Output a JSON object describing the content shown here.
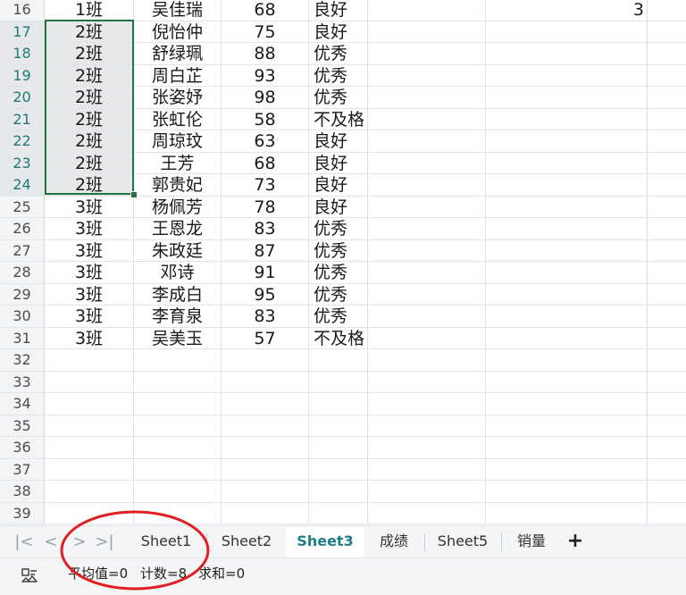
{
  "grid": {
    "rows": [
      {
        "num": "16",
        "selected": false,
        "a": "1班",
        "b": "吴佳瑞",
        "c": "68",
        "d": "良好",
        "f": "3"
      },
      {
        "num": "17",
        "selected": true,
        "a": "2班",
        "b": "倪怡仲",
        "c": "75",
        "d": "良好",
        "f": ""
      },
      {
        "num": "18",
        "selected": true,
        "a": "2班",
        "b": "舒绿珮",
        "c": "88",
        "d": "优秀",
        "f": ""
      },
      {
        "num": "19",
        "selected": true,
        "a": "2班",
        "b": "周白芷",
        "c": "93",
        "d": "优秀",
        "f": ""
      },
      {
        "num": "20",
        "selected": true,
        "a": "2班",
        "b": "张姿妤",
        "c": "98",
        "d": "优秀",
        "f": ""
      },
      {
        "num": "21",
        "selected": true,
        "a": "2班",
        "b": "张虹伦",
        "c": "58",
        "d": "不及格",
        "f": ""
      },
      {
        "num": "22",
        "selected": true,
        "a": "2班",
        "b": "周琼玟",
        "c": "63",
        "d": "良好",
        "f": ""
      },
      {
        "num": "23",
        "selected": true,
        "a": "2班",
        "b": "王芳",
        "c": "68",
        "d": "良好",
        "f": ""
      },
      {
        "num": "24",
        "selected": true,
        "a": "2班",
        "b": "郭贵妃",
        "c": "73",
        "d": "良好",
        "f": ""
      },
      {
        "num": "25",
        "selected": false,
        "a": "3班",
        "b": "杨佩芳",
        "c": "78",
        "d": "良好",
        "f": ""
      },
      {
        "num": "26",
        "selected": false,
        "a": "3班",
        "b": "王恩龙",
        "c": "83",
        "d": "优秀",
        "f": ""
      },
      {
        "num": "27",
        "selected": false,
        "a": "3班",
        "b": "朱政廷",
        "c": "87",
        "d": "优秀",
        "f": ""
      },
      {
        "num": "28",
        "selected": false,
        "a": "3班",
        "b": "邓诗",
        "c": "91",
        "d": "优秀",
        "f": ""
      },
      {
        "num": "29",
        "selected": false,
        "a": "3班",
        "b": "李成白",
        "c": "95",
        "d": "优秀",
        "f": ""
      },
      {
        "num": "30",
        "selected": false,
        "a": "3班",
        "b": "李育泉",
        "c": "83",
        "d": "优秀",
        "f": ""
      },
      {
        "num": "31",
        "selected": false,
        "a": "3班",
        "b": "吴美玉",
        "c": "57",
        "d": "不及格",
        "f": ""
      },
      {
        "num": "32",
        "selected": false,
        "a": "",
        "b": "",
        "c": "",
        "d": "",
        "f": ""
      },
      {
        "num": "33",
        "selected": false,
        "a": "",
        "b": "",
        "c": "",
        "d": "",
        "f": ""
      },
      {
        "num": "34",
        "selected": false,
        "a": "",
        "b": "",
        "c": "",
        "d": "",
        "f": ""
      },
      {
        "num": "35",
        "selected": false,
        "a": "",
        "b": "",
        "c": "",
        "d": "",
        "f": ""
      },
      {
        "num": "36",
        "selected": false,
        "a": "",
        "b": "",
        "c": "",
        "d": "",
        "f": ""
      },
      {
        "num": "37",
        "selected": false,
        "a": "",
        "b": "",
        "c": "",
        "d": "",
        "f": ""
      },
      {
        "num": "38",
        "selected": false,
        "a": "",
        "b": "",
        "c": "",
        "d": "",
        "f": ""
      },
      {
        "num": "39",
        "selected": false,
        "a": "",
        "b": "",
        "c": "",
        "d": "",
        "f": ""
      }
    ]
  },
  "tabbar": {
    "nav": {
      "first": "|<",
      "prev": "<",
      "next": ">",
      "last": ">|"
    },
    "tabs": [
      {
        "label": "Sheet1",
        "active": false
      },
      {
        "label": "Sheet2",
        "active": false
      },
      {
        "label": "Sheet3",
        "active": true
      },
      {
        "label": "成绩",
        "active": false
      },
      {
        "label": "Sheet5",
        "active": false
      },
      {
        "label": "销量",
        "active": false
      }
    ],
    "add_label": "+"
  },
  "statusbar": {
    "icon": "selection-stats-icon",
    "average": "平均值=0",
    "count": "计数=8",
    "sum": "求和=0"
  },
  "colors": {
    "selection_border": "#217346",
    "active_tab_text": "#1d7f86",
    "annotation_circle": "#e02020"
  }
}
